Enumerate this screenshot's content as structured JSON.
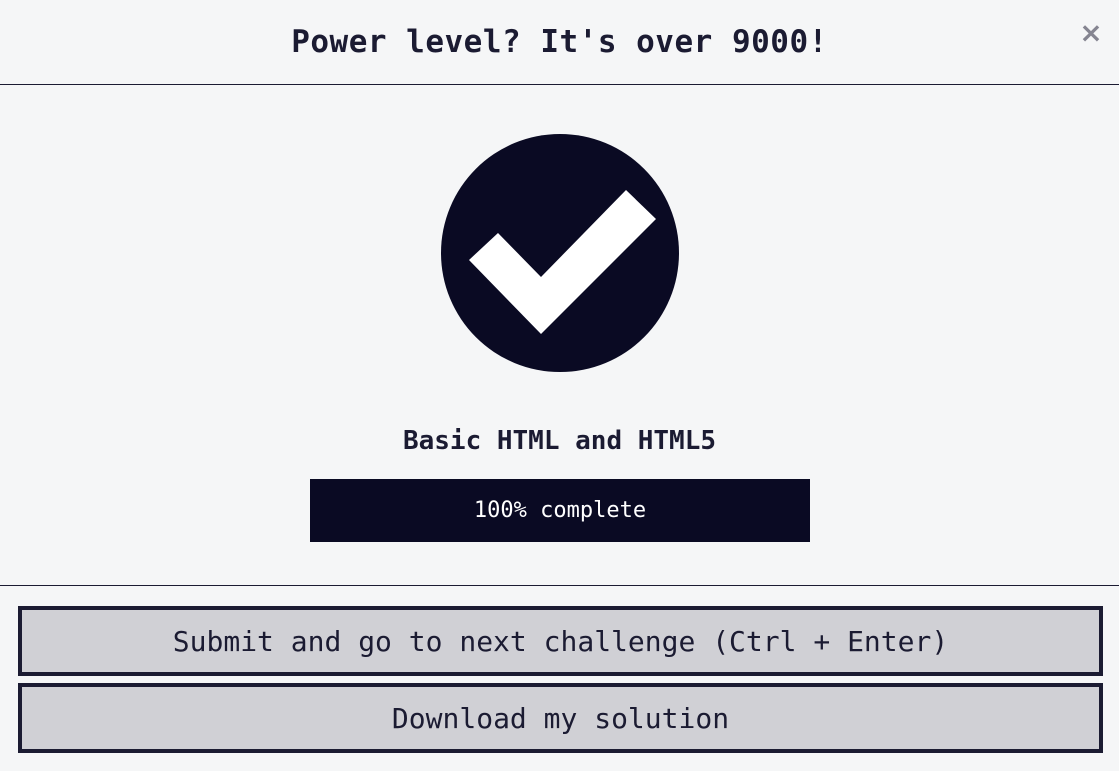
{
  "modal": {
    "title": "Power level? It's over 9000!",
    "close_label": "×"
  },
  "body": {
    "icon": "checkmark-circle-icon",
    "block_title": "Basic HTML and HTML5",
    "progress": {
      "percent": 100,
      "text": "100% complete"
    }
  },
  "footer": {
    "submit_label": "Submit and go to next challenge (Ctrl + Enter)",
    "download_label": "Download my solution"
  },
  "colors": {
    "background": "#f5f6f7",
    "text": "#1b1b32",
    "dark": "#0a0a23",
    "button_bg": "#d0d0d5",
    "close": "#858591"
  }
}
